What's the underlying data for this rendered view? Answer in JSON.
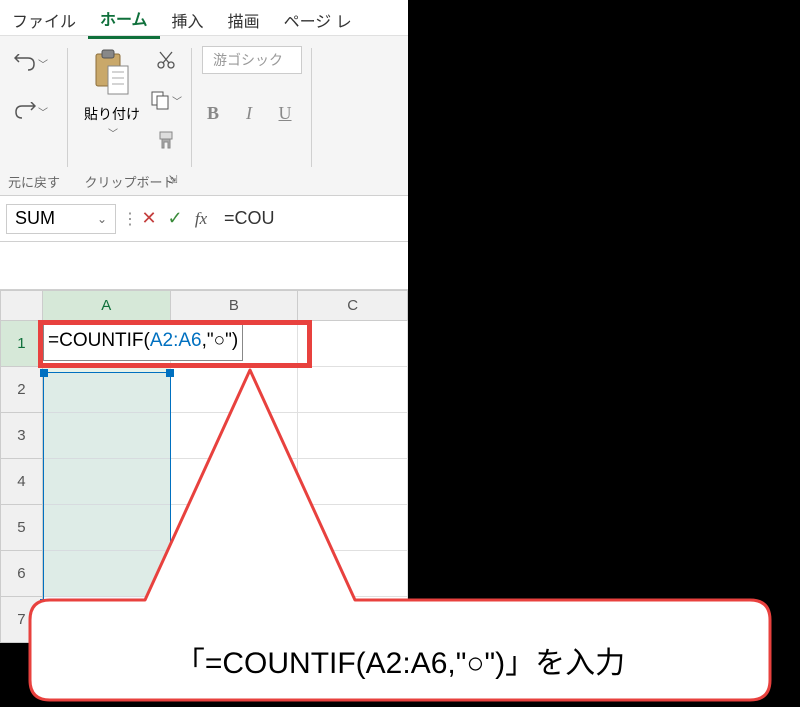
{
  "menu": {
    "file": "ファイル",
    "home": "ホーム",
    "insert": "挿入",
    "draw": "描画",
    "page_layout_partial": "ページ レ"
  },
  "ribbon": {
    "undo_group_label": "元に戻す",
    "clipboard_group_label": "クリップボード",
    "paste_label": "貼り付け",
    "font_name_hint": "游ゴシック",
    "bold_label": "B",
    "italic_label": "I",
    "underline_label": "U"
  },
  "formula_bar": {
    "name_box_value": "SUM",
    "fx_label": "fx",
    "formula_preview": "=COU"
  },
  "grid": {
    "col_headers": [
      "A",
      "B",
      "C"
    ],
    "row_headers": [
      "1",
      "2",
      "3",
      "4",
      "5",
      "6",
      "7"
    ]
  },
  "cell_formula": {
    "part1": "=COUNTIF(",
    "range": "A2:A6",
    "part2": ",\"○\")"
  },
  "callout": {
    "text": "「=COUNTIF(A2:A6,\"○\")」を入力"
  }
}
